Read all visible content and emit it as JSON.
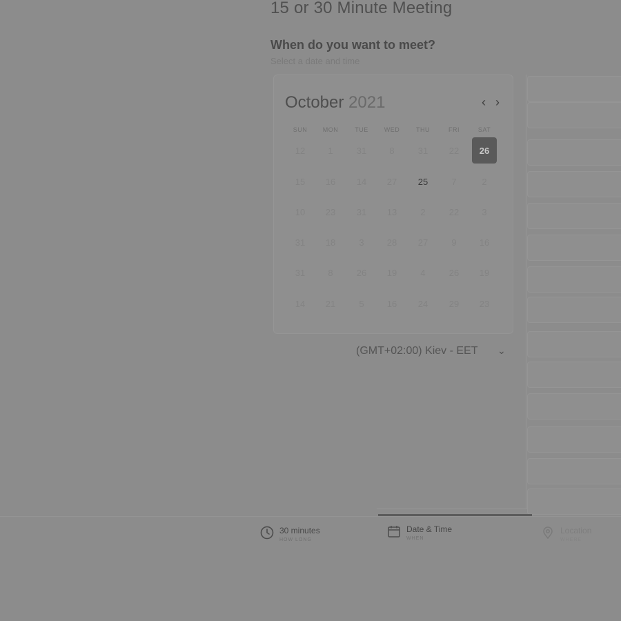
{
  "header": {
    "title": "15 or 30 Minute Meeting",
    "question": "When do you want to meet?",
    "subtitle": "Select a date and time"
  },
  "calendar": {
    "month": "October",
    "year": "2021",
    "prev_icon": "chevron-left-icon",
    "next_icon": "chevron-right-icon",
    "weekdays": [
      "SUN",
      "MON",
      "TUE",
      "WED",
      "THU",
      "FRI",
      "SAT"
    ],
    "weeks": [
      [
        "12",
        "1",
        "31",
        "8",
        "31",
        "22",
        "26"
      ],
      [
        "15",
        "16",
        "14",
        "27",
        "25",
        "7",
        "2"
      ],
      [
        "10",
        "23",
        "31",
        "13",
        "2",
        "22",
        "3"
      ],
      [
        "31",
        "18",
        "3",
        "28",
        "27",
        "9",
        "16"
      ],
      [
        "31",
        "8",
        "26",
        "19",
        "4",
        "26",
        "19"
      ],
      [
        "14",
        "21",
        "5",
        "16",
        "24",
        "29",
        "23"
      ]
    ],
    "available": [
      "25"
    ],
    "selected": "26"
  },
  "timezone": {
    "label": "(GMT+02:00) Kiev - EET",
    "caret_icon": "chevron-down-icon"
  },
  "steps": [
    {
      "label": "30 minutes",
      "sub": "HOW LONG",
      "icon": "clock-icon"
    },
    {
      "label": "Date & Time",
      "sub": "WHEN",
      "icon": "calendar-icon"
    },
    {
      "label": "Location",
      "sub": "WHERE",
      "icon": "location-pin-icon"
    }
  ],
  "colors": {
    "overlay": "#8c8c8c",
    "selected_day": "#5a5a5a"
  }
}
